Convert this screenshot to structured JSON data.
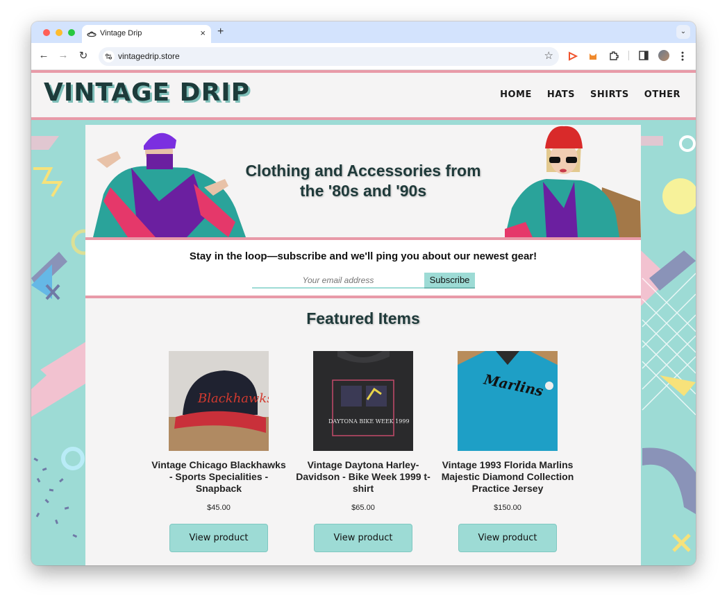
{
  "browser": {
    "tab_title": "Vintage Drip",
    "tab_close": "×",
    "new_tab": "+",
    "tab_menu": "⌄",
    "url": "vintagedrip.store",
    "back": "←",
    "forward": "→",
    "reload": "↻",
    "star": "☆",
    "icons": [
      "back-icon",
      "forward-icon",
      "reload-icon",
      "site-info-icon",
      "bookmark-star-icon",
      "extension-play-icon",
      "extension-fox-icon",
      "extensions-puzzle-icon",
      "side-panel-icon",
      "profile-avatar",
      "menu-kebab-icon"
    ]
  },
  "site": {
    "logo": "VINTAGE DRIP",
    "nav": [
      "HOME",
      "HATS",
      "SHIRTS",
      "OTHER"
    ],
    "hero_title": "Clothing and Accessories from the '80s and '90s",
    "subscribe_text": "Stay in the loop—subscribe and we'll ping you about our newest gear!",
    "email_placeholder": "Your email address",
    "subscribe_button": "Subscribe",
    "featured_heading": "Featured Items",
    "products": [
      {
        "name": "Vintage Chicago Blackhawks - Sports Specialities - Snapback",
        "price": "$45.00",
        "button": "View product"
      },
      {
        "name": "Vintage Daytona Harley-Davidson - Bike Week 1999 t-shirt",
        "price": "$65.00",
        "button": "View product"
      },
      {
        "name": "Vintage 1993 Florida Marlins Majestic Diamond Collection Practice Jersey",
        "price": "$150.00",
        "button": "View product"
      }
    ],
    "product_image_text": [
      "Blackhawks",
      "DAYTONA BIKE WEEK 1999",
      "Marlins"
    ]
  },
  "colors": {
    "page_bg": "#9ddbd5",
    "accent_pink": "#e89aa8",
    "panel": "#f5f4f4",
    "title_teal": "#1f3a3a"
  }
}
